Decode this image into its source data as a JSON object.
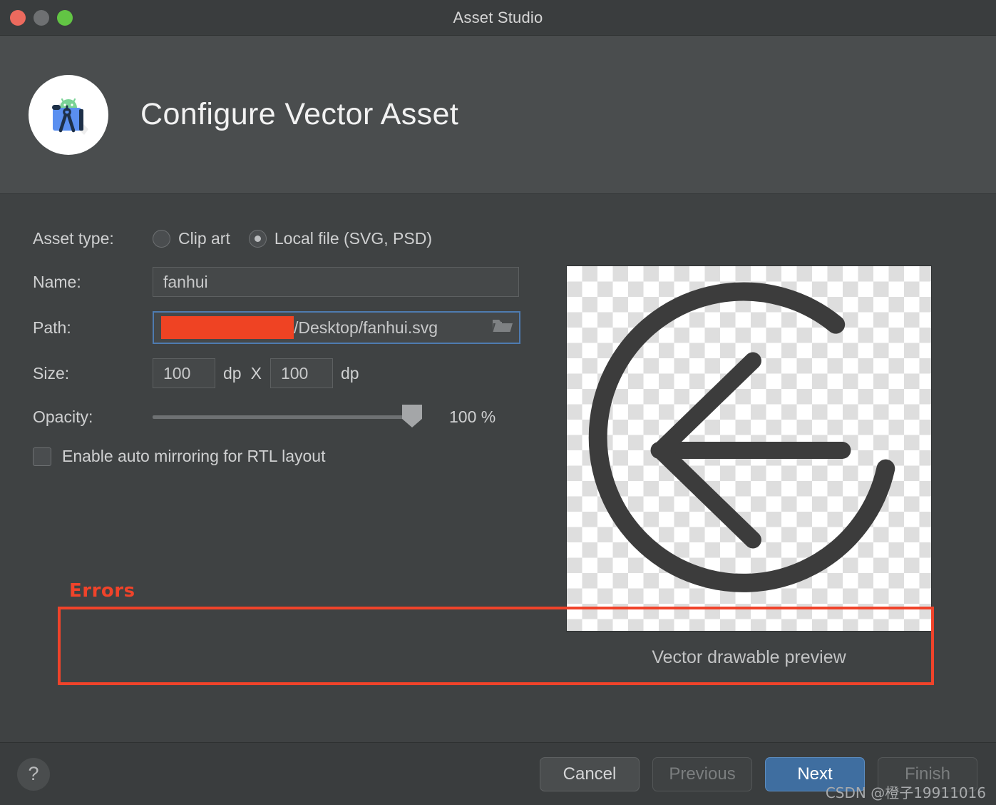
{
  "window": {
    "title": "Asset Studio",
    "traffic_lights": [
      "close",
      "minimize",
      "maximize"
    ]
  },
  "header": {
    "title": "Configure Vector Asset",
    "icon": "android-studio-icon"
  },
  "form": {
    "asset_type": {
      "label": "Asset type:",
      "options": [
        {
          "label": "Clip art",
          "selected": false
        },
        {
          "label": "Local file (SVG, PSD)",
          "selected": true
        }
      ]
    },
    "name": {
      "label": "Name:",
      "value": "fanhui"
    },
    "path": {
      "label": "Path:",
      "value": "/Desktop/fanhui.svg",
      "redacted": true,
      "browse_icon": "folder-icon",
      "focused": true
    },
    "size": {
      "label": "Size:",
      "width": "100",
      "height": "100",
      "unit": "dp",
      "separator": "X"
    },
    "opacity": {
      "label": "Opacity:",
      "value": "100 %",
      "percent": 100
    },
    "mirroring": {
      "label": "Enable auto mirroring for RTL layout",
      "checked": false
    }
  },
  "preview": {
    "caption": "Vector drawable preview",
    "asset": "back-arrow-circle-icon"
  },
  "errors": {
    "title": "Errors",
    "messages": []
  },
  "footer": {
    "help_label": "?",
    "buttons": [
      {
        "label": "Cancel",
        "state": "enabled"
      },
      {
        "label": "Previous",
        "state": "disabled"
      },
      {
        "label": "Next",
        "state": "primary"
      },
      {
        "label": "Finish",
        "state": "disabled"
      }
    ]
  },
  "watermark": "CSDN @橙子19911016",
  "colors": {
    "accent": "#3f6ea0",
    "error": "#f0432a",
    "redaction": "#ef4323",
    "focus_border": "#4e7bb0",
    "window_bg": "#3f4243",
    "header_bg": "#4a4d4e"
  }
}
